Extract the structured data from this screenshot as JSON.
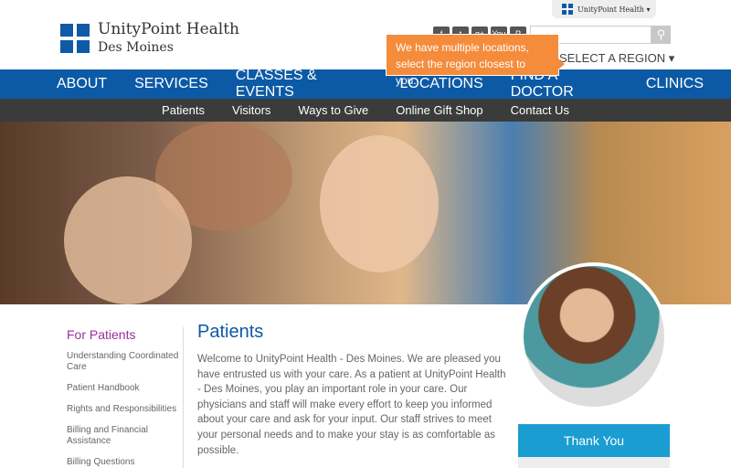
{
  "brand": {
    "name": "UnityPoint Health",
    "location": "Des Moines",
    "switcher_label": "UnityPoint Health"
  },
  "social": [
    {
      "icon": "facebook-icon",
      "glyph": "f"
    },
    {
      "icon": "twitter-icon",
      "glyph": "t"
    },
    {
      "icon": "google-plus-icon",
      "glyph": "g+"
    },
    {
      "icon": "youtube-icon",
      "glyph": "You"
    },
    {
      "icon": "pinterest-icon",
      "glyph": "P"
    }
  ],
  "search": {
    "placeholder": "",
    "icon": "⚲"
  },
  "region": {
    "label": "SELECT A REGION ▾"
  },
  "tooltip": {
    "text": "We have multiple locations, select the region closest to you."
  },
  "nav": [
    "ABOUT",
    "SERVICES",
    "CLASSES & EVENTS",
    "LOCATIONS",
    "FIND A DOCTOR",
    "CLINICS"
  ],
  "subnav": [
    "Patients",
    "Visitors",
    "Ways to Give",
    "Online Gift Shop",
    "Contact Us"
  ],
  "sidebar": {
    "title": "For Patients",
    "items": [
      "Understanding Coordinated Care",
      "Patient Handbook",
      "Rights and Responsibilities",
      "Billing and Financial Assistance",
      "Billing Questions"
    ]
  },
  "content": {
    "title": "Patients",
    "body": "Welcome to UnityPoint Health - Des Moines. We are pleased you have entrusted us with your care. As a patient at UnityPoint Health - Des Moines, you play an important role in your care. Our physicians and staff will make every effort to keep you informed about your care and ask for your input. Our staff strives to meet your personal needs and to make your stay is as comfortable as possible."
  },
  "callout": {
    "title": "Thank You"
  }
}
